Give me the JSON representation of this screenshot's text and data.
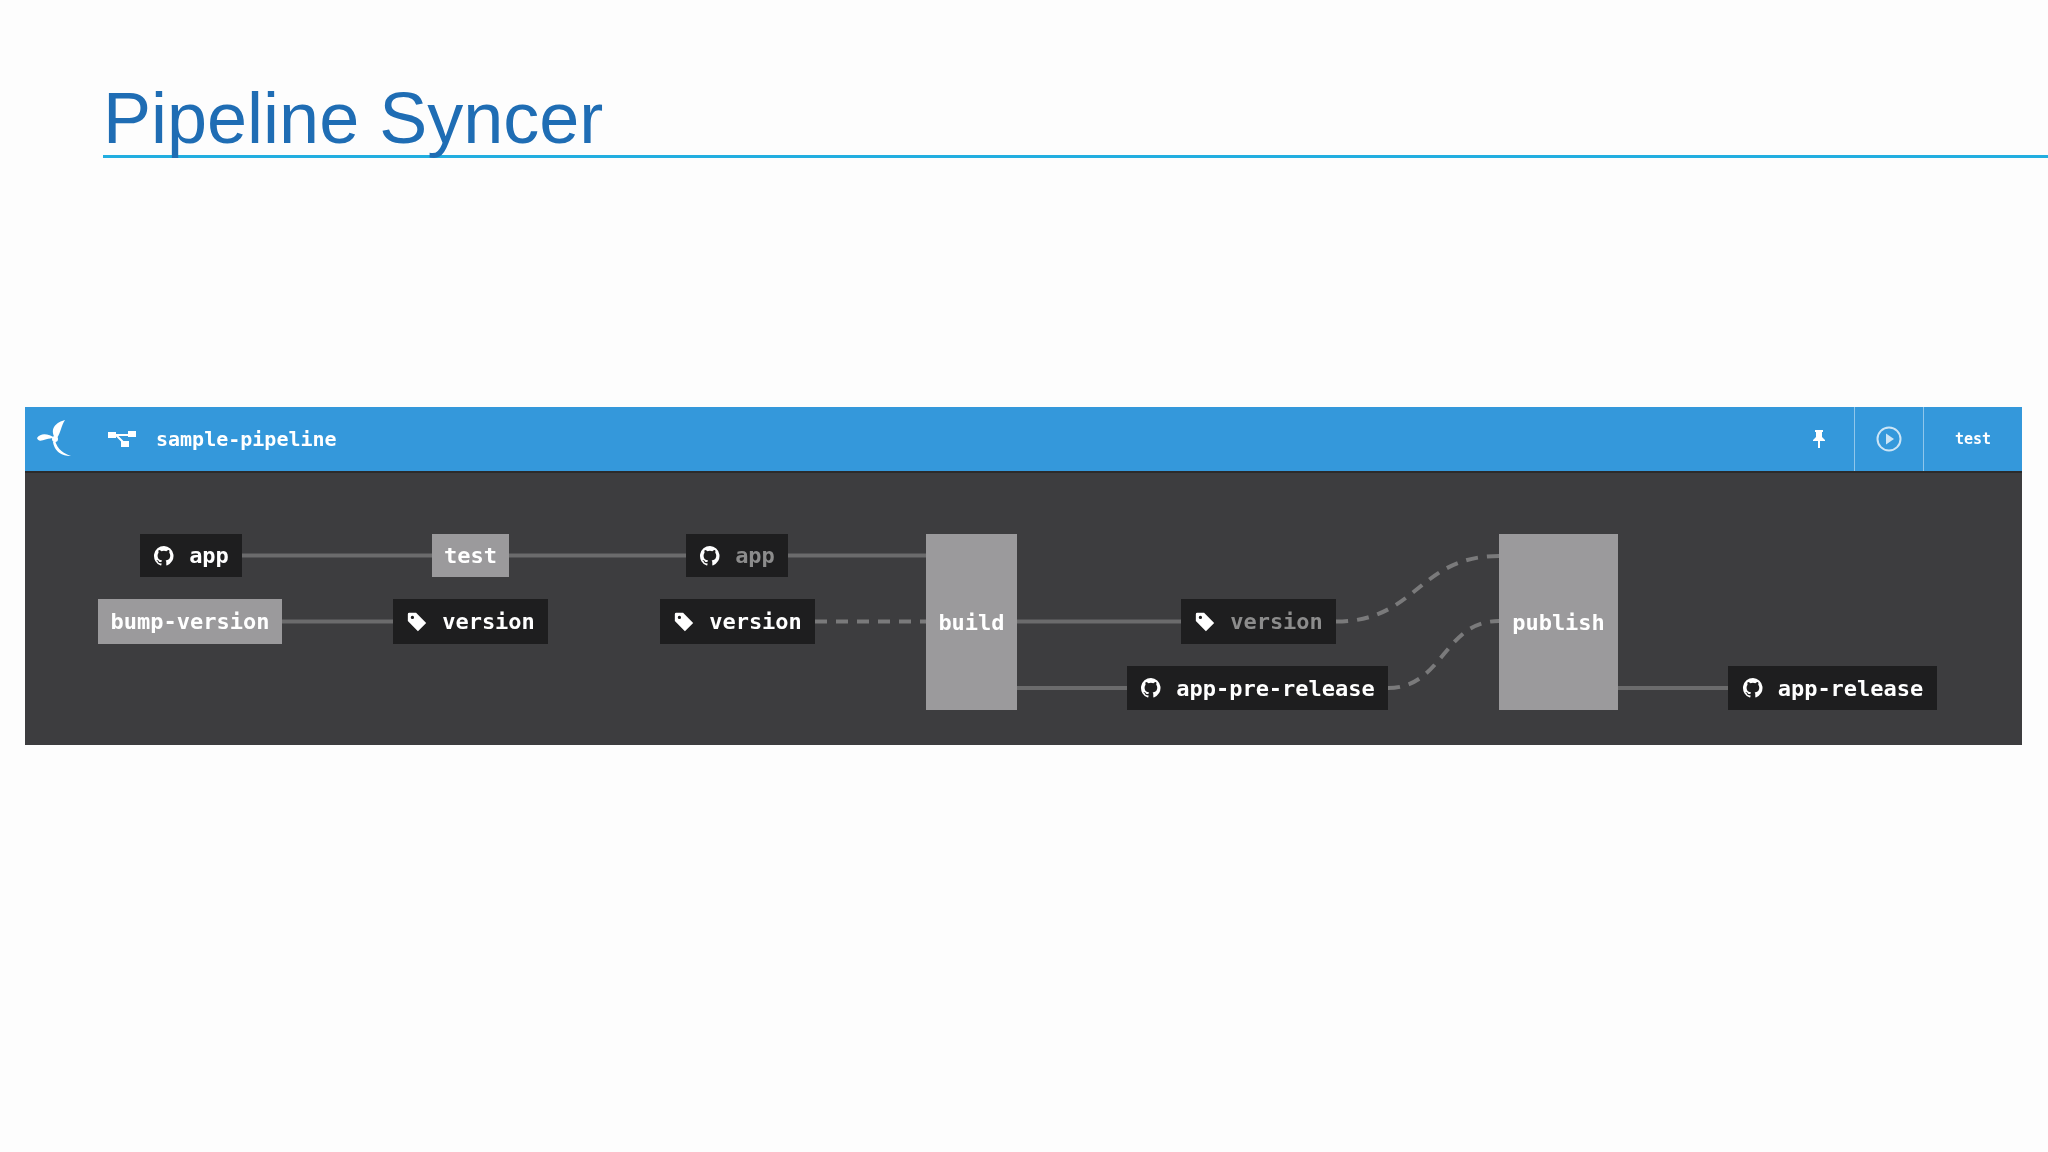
{
  "slide": {
    "title": "Pipeline Syncer"
  },
  "pipeline": {
    "name": "sample-pipeline",
    "user": "test",
    "nodes": [
      {
        "kind": "resource",
        "label": "app",
        "faded": false
      },
      {
        "kind": "job",
        "label": "test"
      },
      {
        "kind": "resource",
        "label": "app",
        "faded": true
      },
      {
        "kind": "job",
        "label": "bump-version"
      },
      {
        "kind": "resource",
        "label": "version",
        "faded": false
      },
      {
        "kind": "resource",
        "label": "version",
        "faded": false
      },
      {
        "kind": "job",
        "label": "build"
      },
      {
        "kind": "resource",
        "label": "version",
        "faded": true
      },
      {
        "kind": "resource",
        "label": "app-pre-release",
        "faded": false
      },
      {
        "kind": "job",
        "label": "publish"
      },
      {
        "kind": "resource",
        "label": "app-release",
        "faded": false
      }
    ]
  }
}
